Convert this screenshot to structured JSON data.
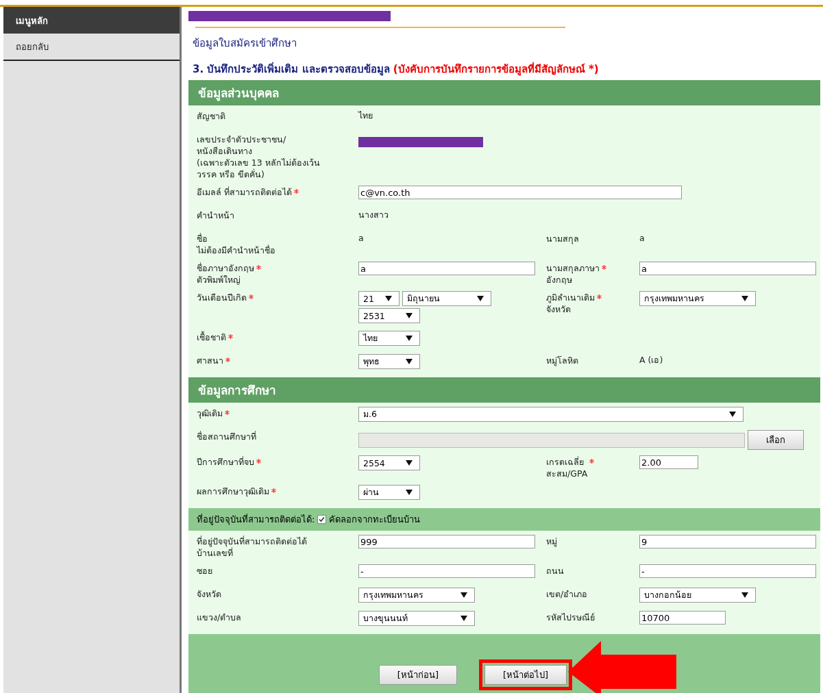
{
  "sidebar": {
    "header": "เมนูหลัก",
    "items": [
      {
        "label": "ถอยกลับ"
      }
    ]
  },
  "page_title": "ข้อมูลใบสมัครเข้าศึกษา",
  "step_heading": {
    "text": "3. บันทึกประวัติเพิ่มเติม และตรวจสอบข้อมูล",
    "note": "(บังคับการบันทึกรายการข้อมูลที่มีสัญลักษณ์ *)"
  },
  "sections": [
    {
      "title": "ข้อมูลส่วนบุคคล",
      "rows": [
        {
          "label": "สัญชาติ",
          "required": false,
          "field": {
            "kind": "text",
            "value": "ไทย"
          }
        },
        {
          "label": "เลขประจำตัวประชาชน/\nหนังสือเดินทาง\n (เฉพาะตัวเลข 13 หลักไม่ต้องเว้น\nวรรค หรือ ขีดคั่น)",
          "required": false,
          "field": {
            "kind": "redacted"
          }
        },
        {
          "label": "อีเมลล์ ที่สามารถติดต่อได้",
          "required": true,
          "field": {
            "kind": "input",
            "value": "c@vn.co.th"
          }
        },
        {
          "label": "คำนำหน้า",
          "required": false,
          "field": {
            "kind": "text",
            "value": "นางสาว"
          }
        },
        {
          "label": "ชื่อ\nไม่ต้องมีคำนำหน้าชื่อ",
          "required": false,
          "field": {
            "kind": "text",
            "value": "a"
          },
          "label2": "นามสกุล",
          "required2": false,
          "field2": {
            "kind": "text",
            "value": "a"
          }
        },
        {
          "label": "ชื่อภาษาอังกฤษ\nตัวพิมพ์ใหญ่",
          "required": true,
          "field": {
            "kind": "input",
            "value": "a"
          },
          "label2": "นามสกุลภาษา\nอังกฤษ",
          "required2": true,
          "field2": {
            "kind": "input",
            "value": "a"
          }
        },
        {
          "label": "วันเดือนปีเกิด",
          "required": true,
          "field": {
            "kind": "selects",
            "values": [
              "21",
              "มิถุนายน",
              "2531"
            ]
          },
          "label2": "ภูมิลำเนาเดิม\nจังหวัด",
          "required2": true,
          "field2": {
            "kind": "selects",
            "values": [
              "กรุงเทพมหานคร"
            ]
          }
        },
        {
          "label": "เชื้อชาติ",
          "required": true,
          "field": {
            "kind": "selects",
            "values": [
              "ไทย"
            ]
          }
        },
        {
          "label": "ศาสนา",
          "required": true,
          "field": {
            "kind": "selects",
            "values": [
              "พุทธ"
            ]
          },
          "label2": "หมู่โลหิต",
          "required2": false,
          "field2": {
            "kind": "text",
            "value": "A (เอ)"
          }
        }
      ]
    },
    {
      "title": "ข้อมูลการศึกษา",
      "rows": [
        {
          "label": "วุฒิเดิม",
          "required": true,
          "field": {
            "kind": "wide_select",
            "value": "ม.6"
          }
        },
        {
          "label": "ชื่อสถานศึกษาที่",
          "required": false,
          "field": {
            "kind": "picker",
            "button": "เลือก"
          }
        },
        {
          "label": "ปีการศึกษาที่จบ",
          "required": true,
          "field": {
            "kind": "selects",
            "values": [
              "2554"
            ]
          },
          "label2": "เกรดเฉลี่ย\nสะสม/GPA",
          "required2": true,
          "field2": {
            "kind": "short_input",
            "value": "2.00"
          }
        },
        {
          "label": "ผลการศึกษาวุฒิเดิม",
          "required": true,
          "field": {
            "kind": "selects",
            "values": [
              "ผ่าน"
            ]
          }
        }
      ]
    },
    {
      "subtitle": "ที่อยู่ปัจจุบันที่สามารถติดต่อได้:",
      "copy": {
        "label": "คัดลอกจากทะเบียนบ้าน",
        "checked": true
      },
      "rows": [
        {
          "label": "ที่อยู่ปัจจุบันที่สามารถติดต่อได้\nบ้านเลขที่",
          "required": false,
          "field": {
            "kind": "input",
            "value": "999"
          },
          "label2": "หมู่",
          "required2": false,
          "field2": {
            "kind": "input",
            "value": "9"
          }
        },
        {
          "label": "ซอย",
          "required": false,
          "field": {
            "kind": "input",
            "value": "-"
          },
          "label2": "ถนน",
          "required2": false,
          "field2": {
            "kind": "input",
            "value": "-"
          }
        },
        {
          "label": "จังหวัด",
          "required": false,
          "field": {
            "kind": "selects",
            "values": [
              "กรุงเทพมหานคร"
            ]
          },
          "label2": "เขต/อำเภอ",
          "required2": false,
          "field2": {
            "kind": "selects",
            "values": [
              "บางกอกน้อย"
            ]
          }
        },
        {
          "label": "แขวง/ตำบล",
          "required": false,
          "field": {
            "kind": "selects",
            "values": [
              "บางขุนนนท์"
            ]
          },
          "label2": "รหัสไปรษณีย์",
          "required2": false,
          "field2": {
            "kind": "short_input",
            "value": "10700"
          }
        }
      ]
    }
  ],
  "buttons": [
    {
      "label": "[หน้าก่อน]",
      "highlighted": false
    },
    {
      "label": "[หน้าต่อไป]",
      "highlighted": true
    }
  ]
}
